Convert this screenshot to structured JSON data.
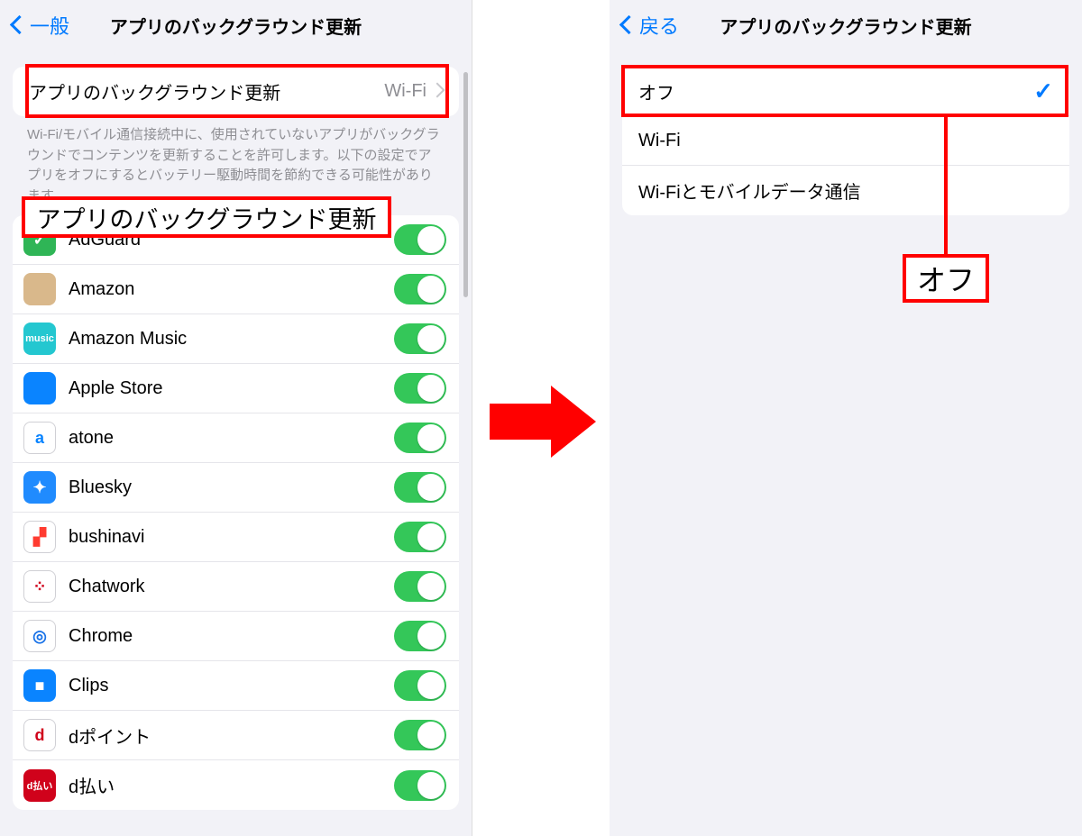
{
  "left": {
    "back_label": "一般",
    "title": "アプリのバックグラウンド更新",
    "master_row": {
      "label": "アプリのバックグラウンド更新",
      "value": "Wi-Fi"
    },
    "footer": "Wi-Fi/モバイル通信接続中に、使用されていないアプリがバックグラウンドでコンテンツを更新することを許可します。以下の設定でアプリをオフにするとバッテリー駆動時間を節約できる可能性があります。",
    "apps": [
      {
        "name": "AdGuard",
        "icon_bg": "#2fb556",
        "icon_txt": "✓"
      },
      {
        "name": "Amazon",
        "icon_bg": "#d9b88b",
        "icon_txt": ""
      },
      {
        "name": "Amazon Music",
        "icon_bg": "#24c7d0",
        "icon_txt": "music",
        "small": true
      },
      {
        "name": "Apple Store",
        "icon_bg": "#0a84ff",
        "icon_txt": ""
      },
      {
        "name": "atone",
        "icon_bg": "#ffffff",
        "icon_txt": "a",
        "fg": "#0a84ff",
        "border": true
      },
      {
        "name": "Bluesky",
        "icon_bg": "#208bfe",
        "icon_txt": "✦"
      },
      {
        "name": "bushinavi",
        "icon_bg": "#ffffff",
        "icon_txt": "▞",
        "fg": "#ff3b30",
        "border": true
      },
      {
        "name": "Chatwork",
        "icon_bg": "#ffffff",
        "icon_txt": "⁘",
        "fg": "#d0021b",
        "border": true
      },
      {
        "name": "Chrome",
        "icon_bg": "#ffffff",
        "icon_txt": "◎",
        "fg": "#1a73e8",
        "border": true
      },
      {
        "name": "Clips",
        "icon_bg": "#0a84ff",
        "icon_txt": "■"
      },
      {
        "name": "dポイント",
        "icon_bg": "#ffffff",
        "icon_txt": "d",
        "fg": "#d0021b",
        "border": true
      },
      {
        "name": "d払い",
        "icon_bg": "#d0021b",
        "icon_txt": "d払い",
        "small": true
      }
    ],
    "annotation_label": "アプリのバックグラウンド更新"
  },
  "right": {
    "back_label": "戻る",
    "title": "アプリのバックグラウンド更新",
    "options": [
      {
        "label": "オフ",
        "selected": true
      },
      {
        "label": "Wi-Fi",
        "selected": false
      },
      {
        "label": "Wi-Fiとモバイルデータ通信",
        "selected": false
      }
    ],
    "annotation_label": "オフ"
  }
}
